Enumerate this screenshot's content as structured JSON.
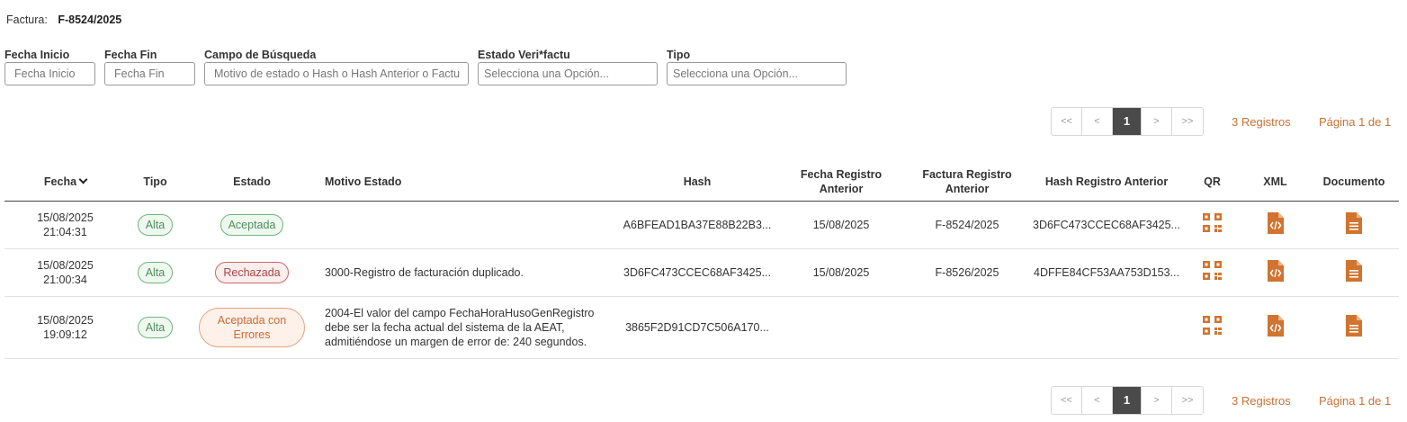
{
  "invoice": {
    "label": "Factura:",
    "number": "F-8524/2025"
  },
  "filters": {
    "fecha_inicio": {
      "label": "Fecha Inicio",
      "placeholder": "Fecha Inicio"
    },
    "fecha_fin": {
      "label": "Fecha Fin",
      "placeholder": "Fecha Fin"
    },
    "campo": {
      "label": "Campo de Búsqueda",
      "placeholder": "Motivo de estado o Hash o Hash Anterior o Factu"
    },
    "estado": {
      "label": "Estado Veri*factu",
      "placeholder": "Selecciona una Opción..."
    },
    "tipo": {
      "label": "Tipo",
      "placeholder": "Selecciona una Opción..."
    }
  },
  "pagination": {
    "first": "<<",
    "prev": "<",
    "current": "1",
    "next": ">",
    "last": ">>",
    "records": "3 Registros",
    "page_info": "Página 1 de 1"
  },
  "table": {
    "headers": {
      "fecha": "Fecha",
      "tipo": "Tipo",
      "estado": "Estado",
      "motivo": "Motivo Estado",
      "hash": "Hash",
      "fecha_ant_1": "Fecha Registro",
      "fecha_ant_2": "Anterior",
      "factura_ant_1": "Factura Registro",
      "factura_ant_2": "Anterior",
      "hash_ant": "Hash Registro Anterior",
      "qr": "QR",
      "xml": "XML",
      "documento": "Documento"
    },
    "rows": [
      {
        "date": "15/08/2025",
        "time": "21:04:31",
        "tipo": "Alta",
        "estado": "Aceptada",
        "motivo": "",
        "hash": "A6BFEAD1BA37E88B22B3...",
        "fecha_ant": "15/08/2025",
        "factura_ant": "F-8524/2025",
        "hash_ant": "3D6FC473CCEC68AF3425..."
      },
      {
        "date": "15/08/2025",
        "time": "21:00:34",
        "tipo": "Alta",
        "estado": "Rechazada",
        "motivo": "3000-Registro de facturación duplicado.",
        "hash": "3D6FC473CCEC68AF3425...",
        "fecha_ant": "15/08/2025",
        "factura_ant": "F-8526/2025",
        "hash_ant": "4DFFE84CF53AA753D153..."
      },
      {
        "date": "15/08/2025",
        "time": "19:09:12",
        "tipo": "Alta",
        "estado_1": "Aceptada con",
        "estado_2": "Errores",
        "motivo_1": "2004-El valor del campo FechaHoraHusoGenRegistro",
        "motivo_2": "debe ser la fecha actual del sistema de la AEAT,",
        "motivo_3": "admitiéndose un margen de error de: 240 segundos.",
        "hash": "3865F2D91CD7C506A170...",
        "fecha_ant": "",
        "factura_ant": "",
        "hash_ant": ""
      }
    ]
  },
  "icons": {
    "qr": "qr-code-icon",
    "xml": "xml-file-icon",
    "document": "document-icon",
    "sort": "chevron-down-icon"
  },
  "colors": {
    "accent": "#d07430",
    "active_page": "#4a4a4a",
    "ok": "#4d8f5b",
    "error": "#a44"
  }
}
